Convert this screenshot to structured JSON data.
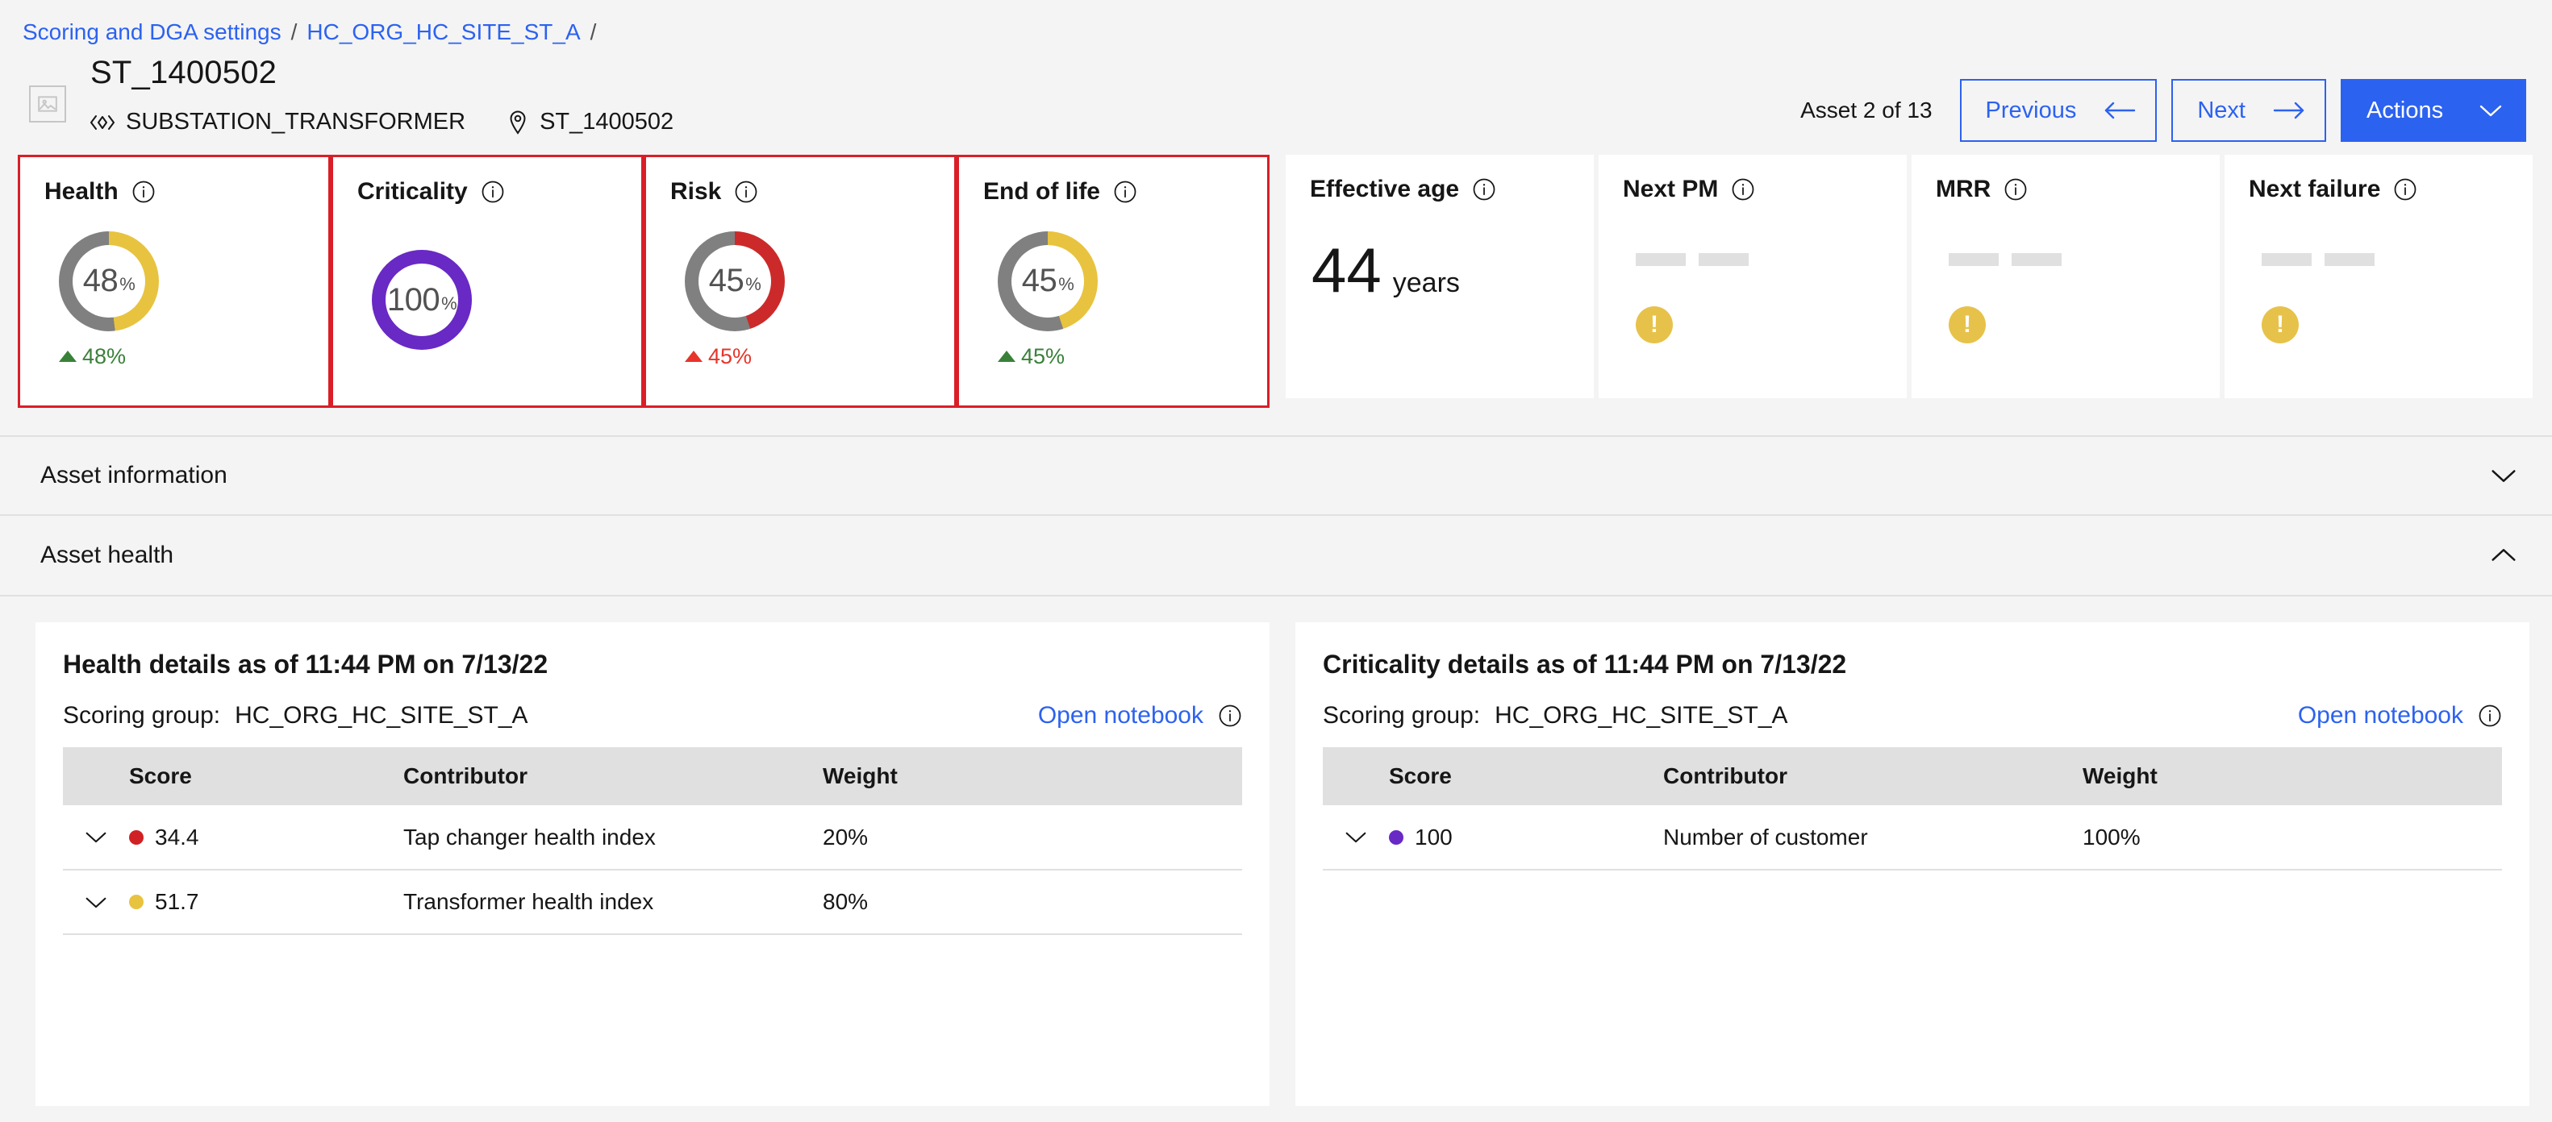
{
  "breadcrumb": {
    "items": [
      {
        "label": "Scoring and DGA settings",
        "link": true
      },
      {
        "label": "HC_ORG_HC_SITE_ST_A",
        "link": true
      }
    ],
    "separator": "/"
  },
  "header": {
    "title": "ST_1400502",
    "asset_type": "SUBSTATION_TRANSFORMER",
    "location": "ST_1400502",
    "thumbnail_icon": "image-placeholder-icon",
    "asset_type_icon": "asset-type-icon",
    "location_icon": "location-pin-icon",
    "asset_count": "Asset 2 of 13",
    "previous_label": "Previous",
    "next_label": "Next",
    "actions_label": "Actions",
    "previous_icon": "arrow-left-icon",
    "next_icon": "arrow-right-icon",
    "actions_icon": "chevron-down-icon"
  },
  "colors": {
    "brand_blue": "#2c62f0",
    "yellow": "#e8c33f",
    "purple": "#6929c4",
    "red": "#cc2a2a",
    "gray_track": "#808080",
    "green_delta": "#398139",
    "red_delta": "#e8342a",
    "highlight_border": "#da1e28",
    "warning_badge": "#e7c24a"
  },
  "kpis": {
    "highlighted": [
      {
        "title": "Health",
        "value": "48",
        "unit": "%",
        "percent": 48,
        "arc_color": "#e8c33f",
        "delta": "48%",
        "delta_direction": "up",
        "delta_color": "#398139",
        "info_icon": "info-icon"
      },
      {
        "title": "Criticality",
        "value": "100",
        "unit": "%",
        "percent": 100,
        "arc_color": "#6929c4",
        "delta": null,
        "info_icon": "info-icon"
      },
      {
        "title": "Risk",
        "value": "45",
        "unit": "%",
        "percent": 45,
        "arc_color": "#cc2a2a",
        "delta": "45%",
        "delta_direction": "up",
        "delta_color": "#e8342a",
        "info_icon": "info-icon"
      },
      {
        "title": "End of life",
        "value": "45",
        "unit": "%",
        "percent": 45,
        "arc_color": "#e8c33f",
        "delta": "45%",
        "delta_direction": "up",
        "delta_color": "#398139",
        "info_icon": "info-icon"
      }
    ],
    "others": [
      {
        "title": "Effective age",
        "type": "value",
        "value": "44",
        "unit": "years",
        "info_icon": "info-icon"
      },
      {
        "title": "Next PM",
        "type": "empty",
        "warning_icon": "warning-icon",
        "info_icon": "info-icon"
      },
      {
        "title": "MRR",
        "type": "empty",
        "warning_icon": "warning-icon",
        "info_icon": "info-icon"
      },
      {
        "title": "Next failure",
        "type": "empty",
        "warning_icon": "warning-icon",
        "info_icon": "info-icon"
      }
    ]
  },
  "accordions": [
    {
      "label": "Asset information",
      "expanded": false,
      "icon": "chevron-down-icon"
    },
    {
      "label": "Asset health",
      "expanded": true,
      "icon": "chevron-up-icon"
    }
  ],
  "panels": [
    {
      "title": "Health details as of 11:44 PM on 7/13/22",
      "scoring_group_label": "Scoring group:",
      "scoring_group_value": "HC_ORG_HC_SITE_ST_A",
      "notebook_link": "Open notebook",
      "notebook_info_icon": "info-icon",
      "columns": [
        "Score",
        "Contributor",
        "Weight"
      ],
      "rows": [
        {
          "score": "34.4",
          "dot_color": "#d02124",
          "contributor": "Tap changer health index",
          "weight": "20%",
          "expand_icon": "chevron-down-icon"
        },
        {
          "score": "51.7",
          "dot_color": "#e8c33f",
          "contributor": "Transformer health index",
          "weight": "80%",
          "expand_icon": "chevron-down-icon"
        }
      ]
    },
    {
      "title": "Criticality details as of 11:44 PM on 7/13/22",
      "scoring_group_label": "Scoring group:",
      "scoring_group_value": "HC_ORG_HC_SITE_ST_A",
      "notebook_link": "Open notebook",
      "notebook_info_icon": "info-icon",
      "columns": [
        "Score",
        "Contributor",
        "Weight"
      ],
      "rows": [
        {
          "score": "100",
          "dot_color": "#6929c4",
          "contributor": "Number of customer",
          "weight": "100%",
          "expand_icon": "chevron-down-icon"
        }
      ]
    }
  ]
}
